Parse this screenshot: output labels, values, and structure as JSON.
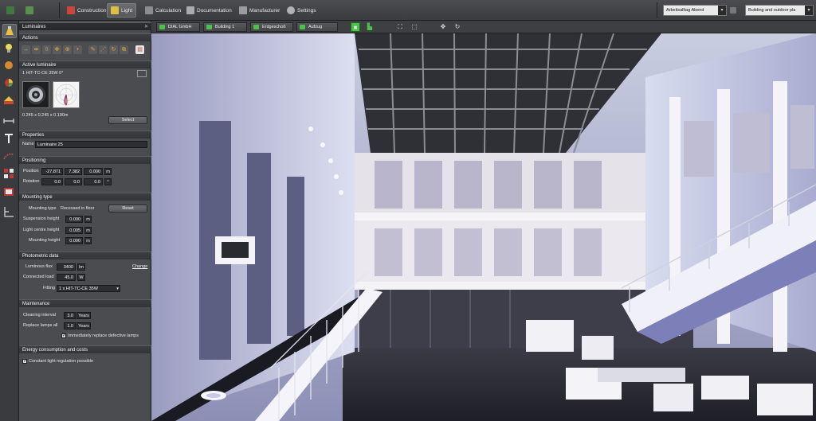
{
  "ribbon": {
    "tabs": [
      {
        "label": "Construction",
        "icon": "construction-icon"
      },
      {
        "label": "Light",
        "icon": "light-icon"
      },
      {
        "label": "Calculation",
        "icon": "calculation-icon"
      },
      {
        "label": "Documentation",
        "icon": "documentation-icon"
      },
      {
        "label": "Manufacturer",
        "icon": "manufacturer-icon"
      },
      {
        "label": "Settings",
        "icon": "settings-icon"
      }
    ],
    "dropdown_view": "Arbeitsalltag Abend",
    "dropdown_mode": "Building and outdoor pla"
  },
  "panel": {
    "title": "Luminaires",
    "actions_header": "Actions",
    "active_header": "Active luminaire",
    "active_name": "1 HIT-TC-CE 35W 0°",
    "dimensions": "0.245 x 0.245 x 0.190m",
    "select_label": "Select",
    "properties_header": "Properties",
    "name_label": "Name",
    "name_value": "Luminaire 25",
    "positioning_header": "Positioning",
    "position_label": "Position",
    "position_x": "-27.871",
    "position_y": "7.382",
    "position_z": "0.000",
    "position_unit": "m",
    "rotation_label": "Rotation",
    "rotation_x": "0.0",
    "rotation_y": "0.0",
    "rotation_z": "0.0",
    "rotation_unit": "°",
    "mounting_header": "Mounting type",
    "mounting_type_label": "Mounting type",
    "mounting_type_value": "Recessed in floor",
    "reset_label": "Reset",
    "suspension_label": "Suspension height",
    "suspension_value": "0.000",
    "light_centre_label": "Light centre height",
    "light_centre_value": "0.005",
    "mounting_height_label": "Mounting height",
    "mounting_height_value": "0.000",
    "length_unit": "m",
    "photometric_header": "Photometric data",
    "flux_label": "Luminous flux",
    "flux_value": "3400",
    "flux_unit": "lm",
    "change_label": "Change",
    "load_label": "Connected load",
    "load_value": "45.0",
    "load_unit": "W",
    "fitting_label": "Fitting",
    "fitting_value": "1 x HIT-TC-CE  35W",
    "maintenance_header": "Maintenance",
    "cleaning_label": "Cleaning interval",
    "cleaning_value": "3.0",
    "cleaning_unit": "Years",
    "replace_label": "Replace lamps all",
    "replace_value": "1.0",
    "replace_unit": "Years",
    "replace_defective_label": "Immediately replace defective lamps",
    "energy_header": "Energy consumption and costs",
    "constant_light_label": "Constant light regulation possible"
  },
  "viewport_toolbar": {
    "crumbs": [
      "DIAL GmbH",
      "Building 1",
      "Erdgeschoß",
      "Aufzug"
    ]
  },
  "colors": {
    "accent_green": "#49c24a",
    "panel_bg": "#4a4c50",
    "header_bg": "#323438"
  }
}
